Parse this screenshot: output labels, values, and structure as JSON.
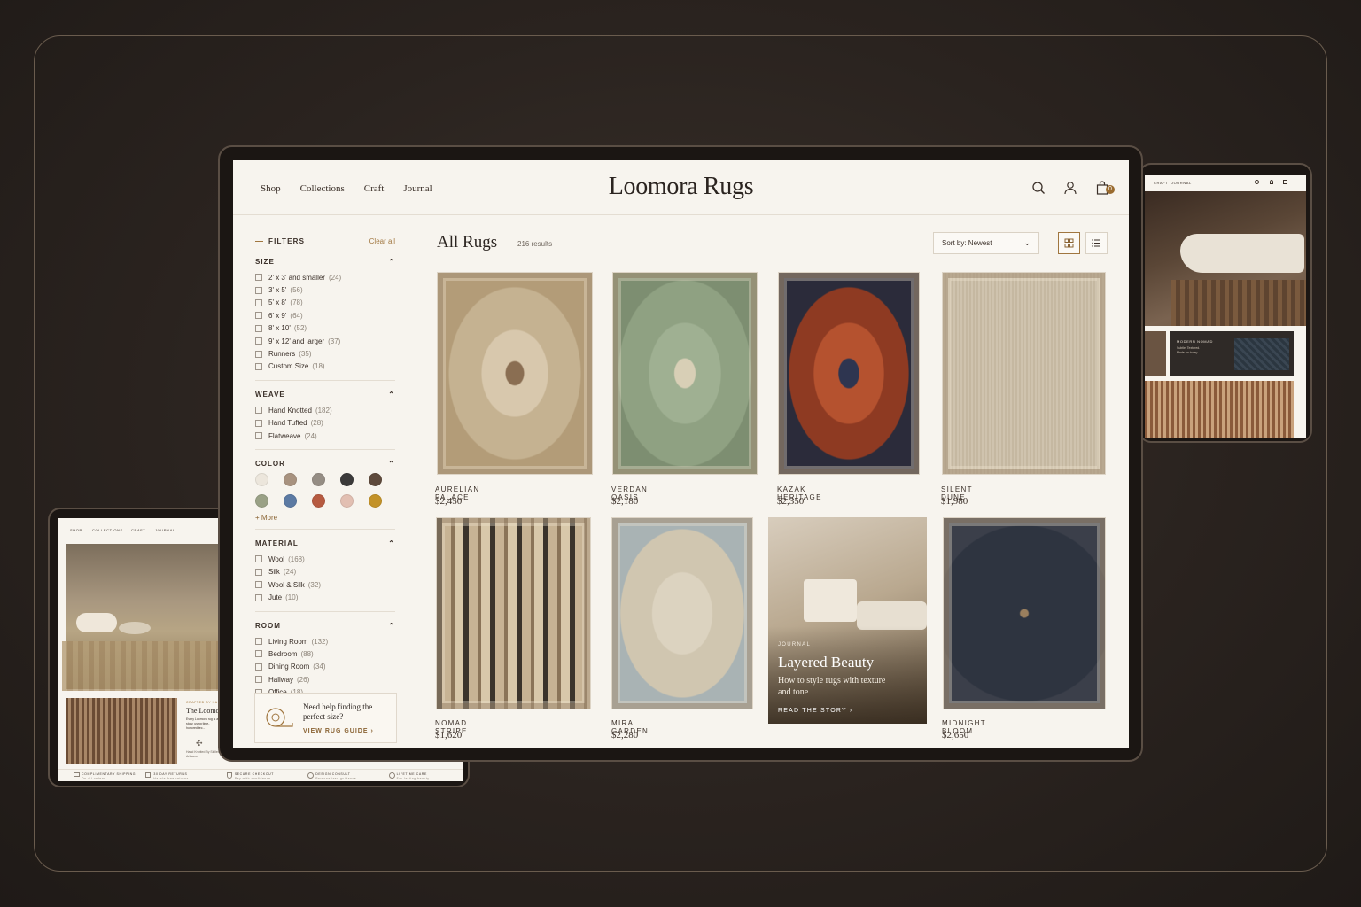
{
  "brand": {
    "name": "Loomora Rugs",
    "accent": "#9a6b2f"
  },
  "nav": [
    "Shop",
    "Collections",
    "Craft",
    "Journal"
  ],
  "header_icons": [
    "search-icon",
    "user-icon",
    "bag-icon"
  ],
  "cart_count": "0",
  "filters": {
    "title": "FILTERS",
    "clear": "Clear all",
    "size": {
      "title": "SIZE",
      "options": [
        {
          "label": "2' x 3' and smaller",
          "count": "(24)"
        },
        {
          "label": "3' x 5'",
          "count": "(56)"
        },
        {
          "label": "5' x 8'",
          "count": "(78)"
        },
        {
          "label": "6' x 9'",
          "count": "(64)"
        },
        {
          "label": "8' x 10'",
          "count": "(52)"
        },
        {
          "label": "9' x 12' and larger",
          "count": "(37)"
        },
        {
          "label": "Runners",
          "count": "(35)"
        },
        {
          "label": "Custom Size",
          "count": "(18)"
        }
      ]
    },
    "weave": {
      "title": "WEAVE",
      "options": [
        {
          "label": "Hand Knotted",
          "count": "(182)"
        },
        {
          "label": "Hand Tufted",
          "count": "(28)"
        },
        {
          "label": "Flatweave",
          "count": "(24)"
        }
      ]
    },
    "color": {
      "title": "COLOR",
      "swatches": [
        "#ece6dc",
        "#a8927f",
        "#958d84",
        "#3b3a3a",
        "#5e4a3c",
        "#9aa186",
        "#5c7aa3",
        "#b65a40",
        "#e2bfb2",
        "#c39228"
      ],
      "more": "+ More"
    },
    "material": {
      "title": "MATERIAL",
      "options": [
        {
          "label": "Wool",
          "count": "(168)"
        },
        {
          "label": "Silk",
          "count": "(24)"
        },
        {
          "label": "Wool & Silk",
          "count": "(32)"
        },
        {
          "label": "Jute",
          "count": "(10)"
        }
      ]
    },
    "room": {
      "title": "ROOM",
      "options": [
        {
          "label": "Living Room",
          "count": "(132)"
        },
        {
          "label": "Bedroom",
          "count": "(88)"
        },
        {
          "label": "Dining Room",
          "count": "(34)"
        },
        {
          "label": "Hallway",
          "count": "(26)"
        },
        {
          "label": "Office",
          "count": "(18)"
        }
      ]
    },
    "help": {
      "question": "Need help finding the perfect size?",
      "link": "VIEW RUG GUIDE"
    }
  },
  "listing": {
    "title": "All Rugs",
    "results": "216 results",
    "sort": "Sort by: Newest"
  },
  "products": [
    {
      "name": "AURELIAN PALACE",
      "price": "$2,450"
    },
    {
      "name": "VERDAN OASIS",
      "price": "$2,180"
    },
    {
      "name": "KAZAK HERITAGE",
      "price": "$2,350"
    },
    {
      "name": "SILENT DUNE",
      "price": "$1,980"
    },
    {
      "name": "NOMAD STRIPE",
      "price": "$1,620"
    },
    {
      "name": "MIRA GARDEN",
      "price": "$2,280"
    },
    {
      "name": "MIDNIGHT BLOOM",
      "price": "$2,650"
    }
  ],
  "promo": {
    "tag": "JOURNAL",
    "title": "Layered Beauty",
    "subtitle": "How to style rugs with texture and tone",
    "link": "READ THE STORY"
  },
  "right_device": {
    "nav": [
      "CRAFT",
      "JOURNAL"
    ],
    "banner_tag": "MODERN NOMAD",
    "banner_text": "Subtle. Textured. Made for today."
  },
  "left_device": {
    "nav": [
      "SHOP",
      "COLLECTIONS",
      "CRAFT",
      "JOURNAL"
    ],
    "story_tag": "CRAFTED BY HAND, BY",
    "story_title": "The Loomor",
    "story_text": "Every Loomora rug is a story, using time-honored tec...",
    "signature": "Hand Knotted By Skilled Artisans",
    "features": [
      {
        "title": "COMPLIMENTARY SHIPPING",
        "sub": "On all orders"
      },
      {
        "title": "30 DAY RETURNS",
        "sub": "Hassle-free returns"
      },
      {
        "title": "SECURE CHECKOUT",
        "sub": "Pay with confidence"
      },
      {
        "title": "DESIGN CONSULT",
        "sub": "Personalized guidance"
      },
      {
        "title": "LIFETIME CARE",
        "sub": "For lasting beauty"
      }
    ]
  }
}
